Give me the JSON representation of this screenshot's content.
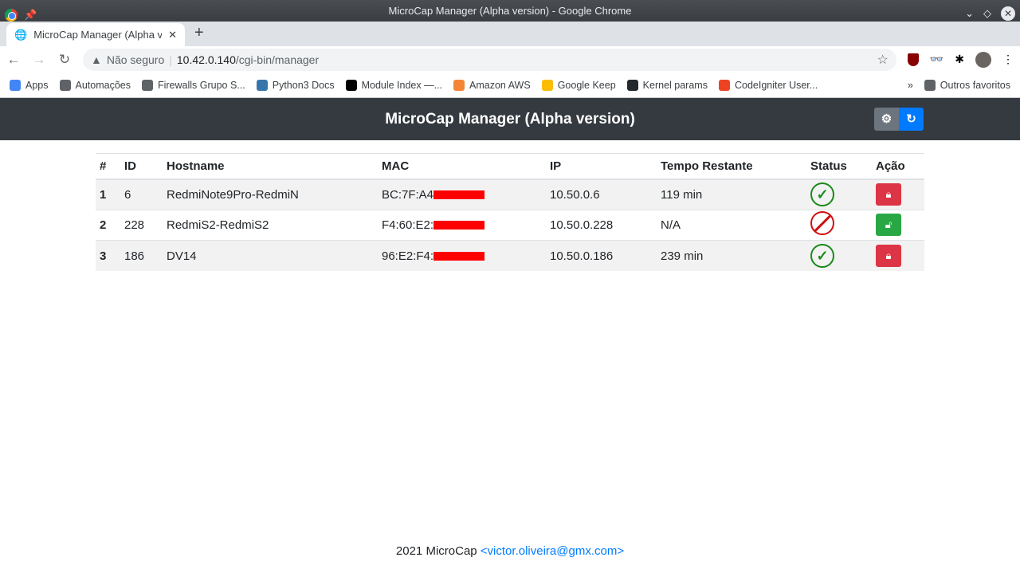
{
  "window": {
    "title": "MicroCap Manager (Alpha version) - Google Chrome"
  },
  "tab": {
    "title": "MicroCap Manager (Alpha version)"
  },
  "omnibox": {
    "security": "Não seguro",
    "host": "10.42.0.140",
    "path": "/cgi-bin/manager"
  },
  "bookmarks": [
    {
      "label": "Apps",
      "icon": "apps-grid-icon",
      "color": "#4285f4"
    },
    {
      "label": "Automações",
      "icon": "folder-icon",
      "color": "#5f6368"
    },
    {
      "label": "Firewalls Grupo S...",
      "icon": "globe-icon",
      "color": "#5f6368"
    },
    {
      "label": "Python3 Docs",
      "icon": "python-icon",
      "color": "#3776ab"
    },
    {
      "label": "Module Index —...",
      "icon": "ansible-icon",
      "color": "#000000"
    },
    {
      "label": "Amazon AWS",
      "icon": "aws-icon",
      "color": "#f58536"
    },
    {
      "label": "Google Keep",
      "icon": "keep-icon",
      "color": "#fbbc04"
    },
    {
      "label": "Kernel params",
      "icon": "github-icon",
      "color": "#24292e"
    },
    {
      "label": "CodeIgniter User...",
      "icon": "codeigniter-icon",
      "color": "#ee4323"
    }
  ],
  "other_bookmarks": "Outros favoritos",
  "header": {
    "title": "MicroCap Manager (Alpha version)"
  },
  "table": {
    "columns": [
      "#",
      "ID",
      "Hostname",
      "MAC",
      "IP",
      "Tempo Restante",
      "Status",
      "Ação"
    ],
    "rows": [
      {
        "n": "1",
        "id": "6",
        "hostname": "RedmiNote9Pro-RedmiN",
        "mac": "BC:7F:A4",
        "ip": "10.50.0.6",
        "time": "119 min",
        "status": "active",
        "action": "lock"
      },
      {
        "n": "2",
        "id": "228",
        "hostname": "RedmiS2-RedmiS2",
        "mac": "F4:60:E2:",
        "ip": "10.50.0.228",
        "time": "N/A",
        "status": "blocked",
        "action": "unlock"
      },
      {
        "n": "3",
        "id": "186",
        "hostname": "DV14",
        "mac": "96:E2:F4:",
        "ip": "10.50.0.186",
        "time": "239 min",
        "status": "active",
        "action": "lock"
      }
    ]
  },
  "footer": {
    "text": "2021 MicroCap ",
    "email": "<victor.oliveira@gmx.com>"
  }
}
